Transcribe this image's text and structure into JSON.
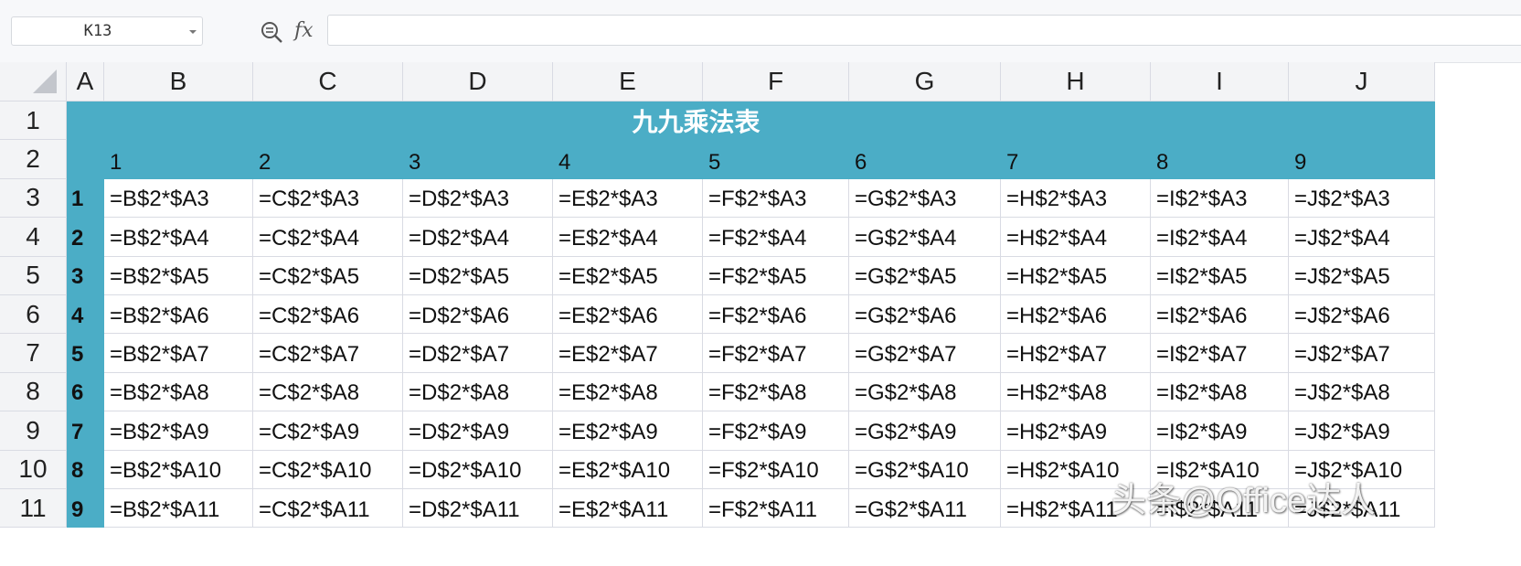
{
  "name_box": "K13",
  "formula_bar": {
    "fx_label": "fx",
    "value": ""
  },
  "columns": [
    "",
    "A",
    "B",
    "C",
    "D",
    "E",
    "F",
    "G",
    "H",
    "I",
    "J"
  ],
  "rows": [
    "1",
    "2",
    "3",
    "4",
    "5",
    "6",
    "7",
    "8",
    "9",
    "10",
    "11"
  ],
  "title": "九九乘法表",
  "multipliers_row": [
    "1",
    "2",
    "3",
    "4",
    "5",
    "6",
    "7",
    "8",
    "9"
  ],
  "multipliers_col": [
    "1",
    "2",
    "3",
    "4",
    "5",
    "6",
    "7",
    "8",
    "9"
  ],
  "formulas": [
    [
      "=B$2*$A3",
      "=C$2*$A3",
      "=D$2*$A3",
      "=E$2*$A3",
      "=F$2*$A3",
      "=G$2*$A3",
      "=H$2*$A3",
      "=I$2*$A3",
      "=J$2*$A3"
    ],
    [
      "=B$2*$A4",
      "=C$2*$A4",
      "=D$2*$A4",
      "=E$2*$A4",
      "=F$2*$A4",
      "=G$2*$A4",
      "=H$2*$A4",
      "=I$2*$A4",
      "=J$2*$A4"
    ],
    [
      "=B$2*$A5",
      "=C$2*$A5",
      "=D$2*$A5",
      "=E$2*$A5",
      "=F$2*$A5",
      "=G$2*$A5",
      "=H$2*$A5",
      "=I$2*$A5",
      "=J$2*$A5"
    ],
    [
      "=B$2*$A6",
      "=C$2*$A6",
      "=D$2*$A6",
      "=E$2*$A6",
      "=F$2*$A6",
      "=G$2*$A6",
      "=H$2*$A6",
      "=I$2*$A6",
      "=J$2*$A6"
    ],
    [
      "=B$2*$A7",
      "=C$2*$A7",
      "=D$2*$A7",
      "=E$2*$A7",
      "=F$2*$A7",
      "=G$2*$A7",
      "=H$2*$A7",
      "=I$2*$A7",
      "=J$2*$A7"
    ],
    [
      "=B$2*$A8",
      "=C$2*$A8",
      "=D$2*$A8",
      "=E$2*$A8",
      "=F$2*$A8",
      "=G$2*$A8",
      "=H$2*$A8",
      "=I$2*$A8",
      "=J$2*$A8"
    ],
    [
      "=B$2*$A9",
      "=C$2*$A9",
      "=D$2*$A9",
      "=E$2*$A9",
      "=F$2*$A9",
      "=G$2*$A9",
      "=H$2*$A9",
      "=I$2*$A9",
      "=J$2*$A9"
    ],
    [
      "=B$2*$A10",
      "=C$2*$A10",
      "=D$2*$A10",
      "=E$2*$A10",
      "=F$2*$A10",
      "=G$2*$A10",
      "=H$2*$A10",
      "=I$2*$A10",
      "=J$2*$A10"
    ],
    [
      "=B$2*$A11",
      "=C$2*$A11",
      "=D$2*$A11",
      "=E$2*$A11",
      "=F$2*$A11",
      "=G$2*$A11",
      "=H$2*$A11",
      "=I$2*$A11",
      "=J$2*$A11"
    ]
  ],
  "watermark": "头条@Office达人",
  "colors": {
    "header_fill": "#4badc6",
    "title_text": "#ffffff",
    "gridline": "#d9dbe3",
    "header_bg": "#f3f4f6"
  },
  "icons": {
    "zoom": "zoom-formula-icon",
    "corner": "select-all-icon",
    "dropdown": "chevron-down-icon"
  }
}
